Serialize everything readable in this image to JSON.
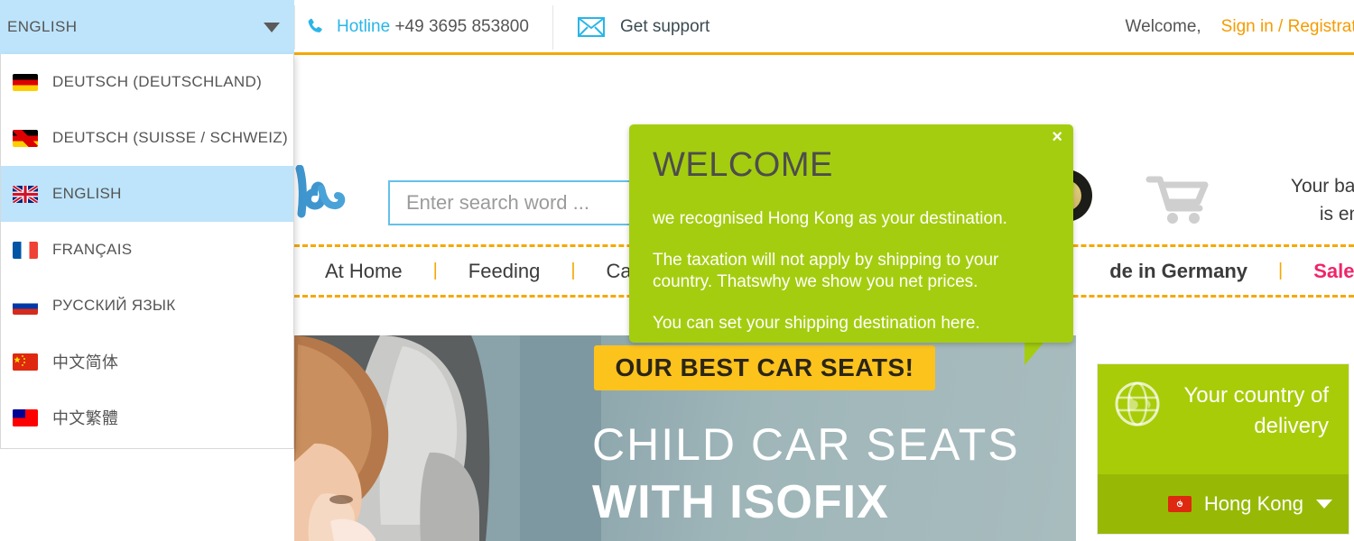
{
  "topbar": {
    "language_selector": {
      "label": "ENGLISH",
      "icon": "chevron-down-icon"
    },
    "hotline": {
      "icon": "phone-icon",
      "label": "Hotline",
      "number": "+49 3695 853800"
    },
    "support": {
      "icon": "envelope-icon",
      "label": "Get support"
    },
    "account": {
      "welcome": "Welcome,",
      "signin": "Sign in / Registration"
    }
  },
  "header": {
    "search": {
      "placeholder": "Enter search word ...",
      "value": "",
      "button_icon": "search-icon"
    },
    "seal": {
      "name": "trust-seal-badge"
    },
    "cart": {
      "icon": "shopping-cart-icon",
      "line1": "Your basket",
      "line2": "is empty"
    }
  },
  "nav": {
    "items": [
      {
        "label": "At Home",
        "style": "normal"
      },
      {
        "label": "Feeding",
        "style": "normal"
      },
      {
        "label": "Care",
        "style": "normal"
      },
      {
        "label": "de in Germany",
        "style": "bold"
      },
      {
        "label": "Sale %",
        "style": "sale"
      }
    ],
    "separator": "|"
  },
  "hero": {
    "badge": "OUR BEST CAR SEATS!",
    "line1": "CHILD CAR SEATS",
    "line2": "WITH ISOFIX"
  },
  "delivery": {
    "icon": "globe-icon",
    "title_line1": "Your country of",
    "title_line2": "delivery",
    "country": "Hong Kong",
    "country_flag": "flag-hong-kong",
    "caret": "chevron-down-icon"
  },
  "tooltip": {
    "title": "WELCOME",
    "p1": "we recognised Hong Kong as your destination.",
    "p2": "The taxation will not apply by shipping to your country. Thatswhy we show you net prices.",
    "p3": "You can set your shipping destination here.",
    "close": "×"
  },
  "language_menu": {
    "items": [
      {
        "label": "DEUTSCH (DEUTSCHLAND)",
        "flag": "f-de",
        "active": false
      },
      {
        "label": "DEUTSCH (SUISSE / SCHWEIZ)",
        "flag": "f-ch",
        "active": false
      },
      {
        "label": "ENGLISH",
        "flag": "f-gb",
        "active": true
      },
      {
        "label": "FRANÇAIS",
        "flag": "f-fr",
        "active": false
      },
      {
        "label": "РУССКИЙ ЯЗЫК",
        "flag": "f-ru",
        "active": false
      },
      {
        "label": "中文简体",
        "flag": "f-cn",
        "active": true
      },
      {
        "label": "中文繁體",
        "flag": "f-tw",
        "active": false
      }
    ]
  },
  "colors": {
    "brand_green": "#a8cc08",
    "tooltip_green": "#a5cd0f",
    "accent_orange": "#f5a800",
    "link_orange": "#f59b00",
    "cyan": "#29b6e8",
    "highlight_blue": "#bde4fb",
    "sale_pink": "#f0256a",
    "badge_yellow": "#fcc31d"
  }
}
